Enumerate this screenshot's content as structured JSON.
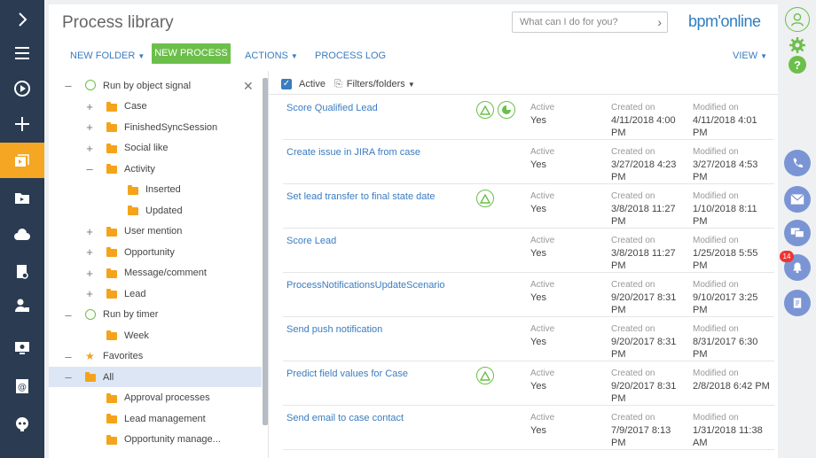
{
  "app": {
    "title": "Process library",
    "search_placeholder": "What can I do for you?",
    "logo": "bpm'online"
  },
  "toolbar": {
    "new_folder": "NEW FOLDER",
    "new_process": "NEW PROCESS",
    "actions": "ACTIONS",
    "process_log": "PROCESS LOG",
    "view": "VIEW"
  },
  "filters": {
    "active_label": "Active",
    "active_checked": true,
    "folders_label": "Filters/folders"
  },
  "tree": [
    {
      "label": "Run by object signal",
      "level": 0,
      "toggle": "–",
      "icon": "signal"
    },
    {
      "label": "Case",
      "level": 1,
      "toggle": "+",
      "icon": "folder"
    },
    {
      "label": "FinishedSyncSession",
      "level": 1,
      "toggle": "+",
      "icon": "folder"
    },
    {
      "label": "Social like",
      "level": 1,
      "toggle": "+",
      "icon": "folder"
    },
    {
      "label": "Activity",
      "level": 1,
      "toggle": "–",
      "icon": "folder"
    },
    {
      "label": "Inserted",
      "level": 2,
      "toggle": "",
      "icon": "folder"
    },
    {
      "label": "Updated",
      "level": 2,
      "toggle": "",
      "icon": "folder"
    },
    {
      "label": "User mention",
      "level": 1,
      "toggle": "+",
      "icon": "folder"
    },
    {
      "label": "Opportunity",
      "level": 1,
      "toggle": "+",
      "icon": "folder"
    },
    {
      "label": "Message/comment",
      "level": 1,
      "toggle": "+",
      "icon": "folder"
    },
    {
      "label": "Lead",
      "level": 1,
      "toggle": "+",
      "icon": "folder"
    },
    {
      "label": "Run by timer",
      "level": 0,
      "toggle": "–",
      "icon": "timer"
    },
    {
      "label": "Week",
      "level": 1,
      "toggle": "",
      "icon": "folder"
    },
    {
      "label": "Favorites",
      "level": 0,
      "toggle": "–",
      "icon": "star"
    },
    {
      "label": "All",
      "level": 0,
      "toggle": "–",
      "icon": "folder",
      "selected": true
    },
    {
      "label": "Approval processes",
      "level": 1,
      "toggle": "",
      "icon": "folder"
    },
    {
      "label": "Lead management",
      "level": 1,
      "toggle": "",
      "icon": "folder"
    },
    {
      "label": "Opportunity manage...",
      "level": 1,
      "toggle": "",
      "icon": "folder"
    }
  ],
  "columns": {
    "active": "Active",
    "created": "Created on",
    "modified": "Modified on"
  },
  "processes": [
    {
      "name": "Score Qualified Lead",
      "icons": [
        "signal-icon",
        "timer-icon"
      ],
      "active": "Yes",
      "created": "4/11/2018 4:00 PM",
      "modified": "4/11/2018 4:01 PM"
    },
    {
      "name": "Create issue in JIRA from case",
      "icons": [],
      "active": "Yes",
      "created": "3/27/2018 4:23 PM",
      "modified": "3/27/2018 4:53 PM"
    },
    {
      "name": "Set lead transfer to final state date",
      "icons": [
        "signal-icon"
      ],
      "active": "Yes",
      "created": "3/8/2018 11:27 PM",
      "modified": "1/10/2018 8:11 PM"
    },
    {
      "name": "Score Lead",
      "icons": [],
      "active": "Yes",
      "created": "3/8/2018 11:27 PM",
      "modified": "1/25/2018 5:55 PM"
    },
    {
      "name": "ProcessNotificationsUpdateScenario",
      "icons": [],
      "active": "Yes",
      "created": "9/20/2017 8:31 PM",
      "modified": "9/10/2017 3:25 PM"
    },
    {
      "name": "Send push notification",
      "icons": [],
      "active": "Yes",
      "created": "9/20/2017 8:31 PM",
      "modified": "8/31/2017 6:30 PM"
    },
    {
      "name": "Predict field values for Case",
      "icons": [
        "signal-icon"
      ],
      "active": "Yes",
      "created": "9/20/2017 8:31 PM",
      "modified": "2/8/2018 6:42 PM"
    },
    {
      "name": "Send email to case contact",
      "icons": [],
      "active": "Yes",
      "created": "7/9/2017 8:13 PM",
      "modified": "1/31/2018 11:38 AM"
    }
  ],
  "notifications": {
    "count": "14"
  },
  "colors": {
    "accent": "#3a7cc0",
    "green": "#6cbf4a",
    "orange": "#f5a623",
    "sidebar": "#2a3b52"
  }
}
